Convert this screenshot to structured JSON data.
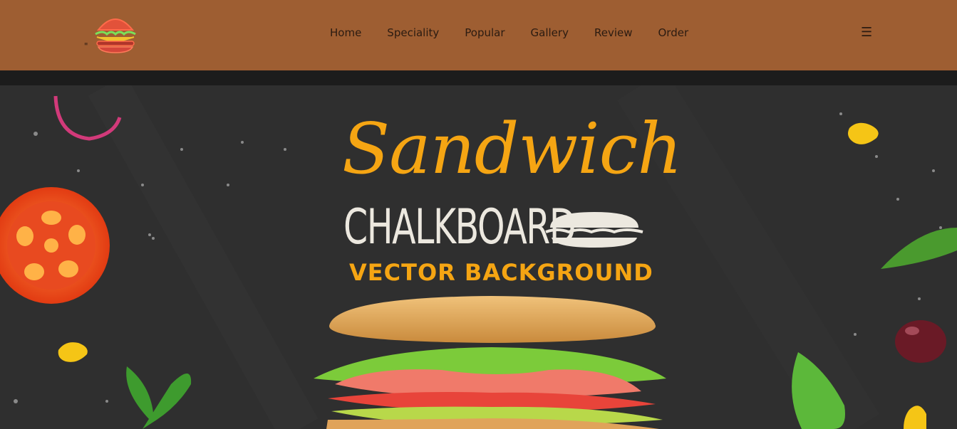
{
  "brand": {
    "logo_name": "burger-neon-logo",
    "stray_mark": "\""
  },
  "nav": {
    "items": [
      {
        "label": "Home"
      },
      {
        "label": "Speciality"
      },
      {
        "label": "Popular"
      },
      {
        "label": "Gallery"
      },
      {
        "label": "Review"
      },
      {
        "label": "Order"
      }
    ],
    "menu_icon": "hamburger-menu-icon"
  },
  "hero": {
    "title": "Sandwich",
    "subtitle": "CHALKBOARD",
    "tagline": "VECTOR BACKGROUND"
  },
  "colors": {
    "header_bg": "#9e5e32",
    "accent": "#f5a513",
    "chalkboard": "#2f2f2f"
  }
}
